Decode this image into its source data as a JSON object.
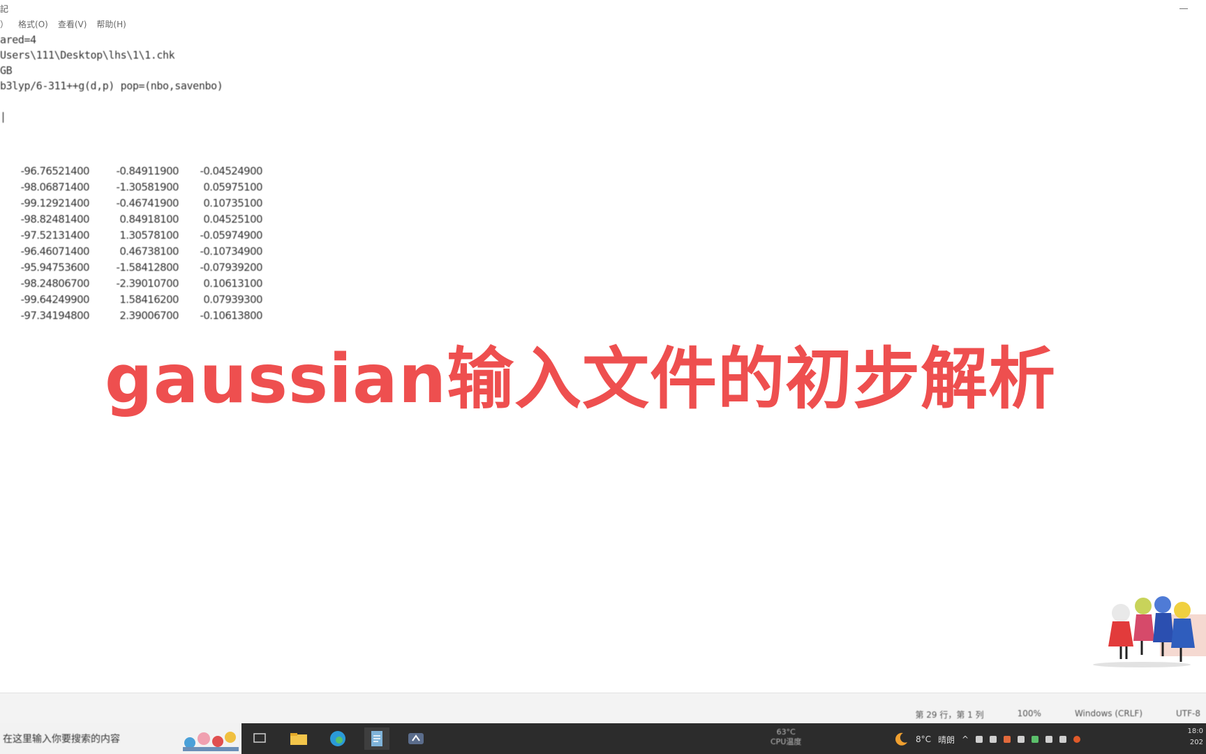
{
  "window": {
    "title_char": "記",
    "menu": [
      "）",
      "格式(O)",
      "查看(V)",
      "帮助(H)"
    ]
  },
  "editor": {
    "lines": [
      "ared=4",
      "Users\\111\\Desktop\\lhs\\1\\1.chk",
      "GB",
      "b3lyp/6-311++g(d,p) pop=(nbo,savenbo)",
      "|"
    ],
    "coords": [
      [
        "-96.76521400",
        "-0.84911900",
        "-0.04524900"
      ],
      [
        "-98.06871400",
        "-1.30581900",
        "0.05975100"
      ],
      [
        "-99.12921400",
        "-0.46741900",
        "0.10735100"
      ],
      [
        "-98.82481400",
        "0.84918100",
        "0.04525100"
      ],
      [
        "-97.52131400",
        "1.30578100",
        "-0.05974900"
      ],
      [
        "-96.46071400",
        "0.46738100",
        "-0.10734900"
      ],
      [
        "-95.94753600",
        "-1.58412800",
        "-0.07939200"
      ],
      [
        "-98.24806700",
        "-2.39010700",
        "0.10613100"
      ],
      [
        "-99.64249900",
        "1.58416200",
        "0.07939300"
      ],
      [
        "-97.34194800",
        "2.39006700",
        "-0.10613800"
      ]
    ]
  },
  "caption": "gaussian输入文件的初步解析",
  "status_bar": {
    "position": "第 29 行，第 1 列",
    "zoom": "100%",
    "line_ending": "Windows (CRLF)",
    "encoding": "UTF-8"
  },
  "taskbar": {
    "search_placeholder": "在这里输入你要搜索的内容",
    "icons": [
      "task-view-icon",
      "file-explorer-icon",
      "edge-icon",
      "notepad-icon",
      "app-icon"
    ],
    "weather_temp": "63°C",
    "weather_desc": "CPU温度",
    "tray_temp": "8°C",
    "tray_weather": "晴朗",
    "clock_time": "18:0",
    "clock_date": "202"
  }
}
